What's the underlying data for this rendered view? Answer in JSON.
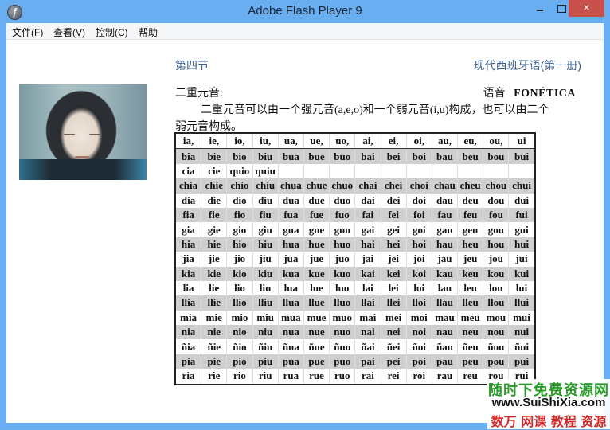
{
  "window": {
    "title": "Adobe Flash Player 9",
    "icons": {
      "app": "flash-player-icon",
      "minimize": "minimize-icon",
      "maximize": "maximize-icon",
      "close": "close-icon"
    },
    "close_glyph": "×"
  },
  "menubar": {
    "items": [
      {
        "label": "文件(F)"
      },
      {
        "label": "查看(V)"
      },
      {
        "label": "控制(C)"
      },
      {
        "label": "帮助"
      }
    ]
  },
  "content": {
    "section_title": "第四节",
    "book_title": "现代西班牙语(第一册)",
    "subhead": "二重元音:",
    "phonetics_cn": "语音",
    "phonetics_es": "FONÉTICA",
    "paragraph_line1": "二重元音可以由一个强元音(a,e,o)和一个弱元音(i,u)构成，也可以由二个",
    "paragraph_line2": "弱元音构成。",
    "video": {
      "description": "webcam-video-feed"
    }
  },
  "table": {
    "header": [
      "ia,",
      "ie,",
      "io,",
      "iu,",
      "ua,",
      "ue,",
      "uo,",
      "ai,",
      "ei,",
      "oi,",
      "au,",
      "eu,",
      "ou,",
      "ui"
    ],
    "rows": [
      [
        "bia",
        "bie",
        "bio",
        "biu",
        "bua",
        "bue",
        "buo",
        "bai",
        "bei",
        "boi",
        "bau",
        "beu",
        "bou",
        "bui"
      ],
      [
        "cia",
        "cie",
        "quio",
        "quiu",
        "",
        "",
        "",
        "",
        "",
        "",
        "",
        "",
        "",
        ""
      ],
      [
        "chia",
        "chie",
        "chio",
        "chiu",
        "chua",
        "chue",
        "chuo",
        "chai",
        "chei",
        "choi",
        "chau",
        "cheu",
        "chou",
        "chui"
      ],
      [
        "dia",
        "die",
        "dio",
        "diu",
        "dua",
        "due",
        "duo",
        "dai",
        "dei",
        "doi",
        "dau",
        "deu",
        "dou",
        "dui"
      ],
      [
        "fia",
        "fie",
        "fio",
        "fiu",
        "fua",
        "fue",
        "fuo",
        "fai",
        "fei",
        "foi",
        "fau",
        "feu",
        "fou",
        "fui"
      ],
      [
        "gia",
        "gie",
        "gio",
        "giu",
        "gua",
        "gue",
        "guo",
        "gai",
        "gei",
        "goi",
        "gau",
        "geu",
        "gou",
        "gui"
      ],
      [
        "hia",
        "hie",
        "hio",
        "hiu",
        "hua",
        "hue",
        "huo",
        "hai",
        "hei",
        "hoi",
        "hau",
        "heu",
        "hou",
        "hui"
      ],
      [
        "jia",
        "jie",
        "jio",
        "jiu",
        "jua",
        "jue",
        "juo",
        "jai",
        "jei",
        "joi",
        "jau",
        "jeu",
        "jou",
        "jui"
      ],
      [
        "kia",
        "kie",
        "kio",
        "kiu",
        "kua",
        "kue",
        "kuo",
        "kai",
        "kei",
        "koi",
        "kau",
        "keu",
        "kou",
        "kui"
      ],
      [
        "lia",
        "lie",
        "lio",
        "liu",
        "lua",
        "lue",
        "luo",
        "lai",
        "lei",
        "loi",
        "lau",
        "leu",
        "lou",
        "lui"
      ],
      [
        "llia",
        "llie",
        "llio",
        "lliu",
        "llua",
        "llue",
        "lluo",
        "llai",
        "llei",
        "lloi",
        "llau",
        "lleu",
        "llou",
        "llui"
      ],
      [
        "mia",
        "mie",
        "mio",
        "miu",
        "mua",
        "mue",
        "muo",
        "mai",
        "mei",
        "moi",
        "mau",
        "meu",
        "mou",
        "mui"
      ],
      [
        "nia",
        "nie",
        "nio",
        "niu",
        "nua",
        "nue",
        "nuo",
        "nai",
        "nei",
        "noi",
        "nau",
        "neu",
        "nou",
        "nui"
      ],
      [
        "ñia",
        "ñie",
        "ñio",
        "ñiu",
        "ñua",
        "ñue",
        "ñuo",
        "ñai",
        "ñei",
        "ñoi",
        "ñau",
        "ñeu",
        "ñou",
        "ñui"
      ],
      [
        "pia",
        "pie",
        "pio",
        "piu",
        "pua",
        "pue",
        "puo",
        "pai",
        "pei",
        "poi",
        "pau",
        "peu",
        "pou",
        "pui"
      ],
      [
        "ria",
        "rie",
        "rio",
        "riu",
        "rua",
        "rue",
        "ruo",
        "rai",
        "rei",
        "roi",
        "rau",
        "reu",
        "rou",
        "rui"
      ]
    ],
    "shade_color": "#cfcfcf"
  },
  "watermark": {
    "line1": "随时下免费资源网",
    "line2": "www.SuiShiXia.com",
    "line3": "数万 网课 教程 资源",
    "colors": {
      "line1": "#2a9a2a",
      "line3": "#d02a2a"
    }
  },
  "colors": {
    "titlebar": "#6aaef2",
    "close_button": "#c7504a",
    "heading_blue": "#3b5f8a"
  }
}
